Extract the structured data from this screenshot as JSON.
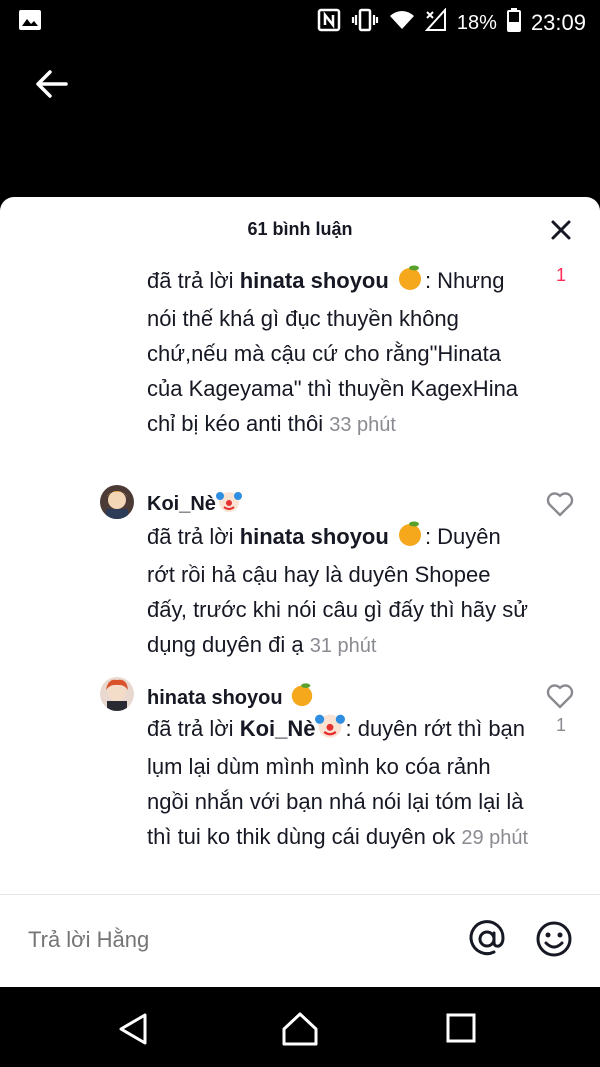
{
  "status_bar": {
    "battery": "18%",
    "time": "23:09"
  },
  "sheet": {
    "title": "61 bình luận"
  },
  "comments": [
    {
      "reply_prefix": "đã trả lời ",
      "mention": "hinata shoyou",
      "text": ": Nhưng nói thế khá gì đục thuyền không chứ,nếu mà cậu cứ cho rằng\"Hinata của Kageyama\" thì thuyền KagexHina chỉ bị kéo anti thôi",
      "time": "33 phút",
      "likes": "1"
    },
    {
      "username": "Koi_Nè",
      "reply_prefix": "đã trả lời ",
      "mention": "hinata shoyou",
      "text": ": Duyên rớt rồi hả cậu hay là duyên Shopee đấy, trước khi nói câu gì đấy thì hãy sử dụng duyên đi ạ",
      "time": "31 phút",
      "likes": ""
    },
    {
      "username": "hinata shoyou",
      "reply_prefix": "đã trả lời ",
      "mention": "Koi_Nè",
      "text": ": duyên rớt thì bạn lụm lại dùm mình mình ko cóa rảnh ngồi nhắn với bạn nhá nói lại tóm lại là thì tui ko thik dùng cái duyên ok",
      "time": "29 phút",
      "likes": "1"
    }
  ],
  "input": {
    "placeholder": "Trả lời Hằng"
  },
  "colors": {
    "like_red": "#fe2c55",
    "muted": "#8a8b91"
  }
}
